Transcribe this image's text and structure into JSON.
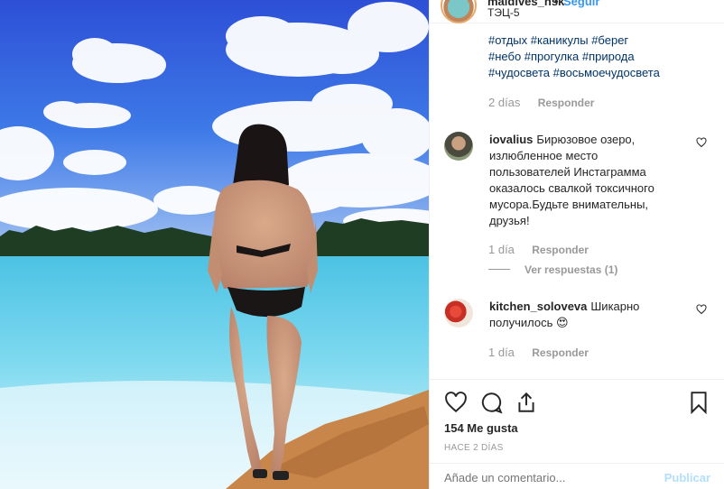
{
  "post": {
    "username": "maldives_nsk",
    "follow_label": "Seguir",
    "location": "ТЭЦ-5",
    "more_icon": "more-horizontal-icon"
  },
  "caption": {
    "hashtags_line1": "#отдых #каникулы #берег",
    "hashtags_line2": "#небо #прогулка #природа",
    "hashtags_line3": "#чудосвета #восьмоечудосвета",
    "time": "2 días",
    "reply_label": "Responder"
  },
  "comments": [
    {
      "username": "iovalius",
      "text": "Бирюзовое озеро, излюбленное место пользователей Инстаграмма оказалось свалкой токсичного мусора.Будьте внимательны, друзья!",
      "time": "1 día",
      "reply_label": "Responder",
      "view_replies": "Ver respuestas (1)"
    },
    {
      "username": "kitchen_soloveva",
      "text": "Шикарно получилось 😍",
      "time": "1 día",
      "reply_label": "Responder"
    }
  ],
  "actions": {
    "likes": "154 Me gusta",
    "posted_ago": "HACE 2 DÍAS",
    "add_comment_placeholder": "Añade un comentario...",
    "publish_label": "Publicar"
  },
  "colors": {
    "link_blue": "#3897f0",
    "hashtag_blue": "#003569",
    "muted_gray": "#999999",
    "lake_turquoise": "#55c9e6"
  }
}
